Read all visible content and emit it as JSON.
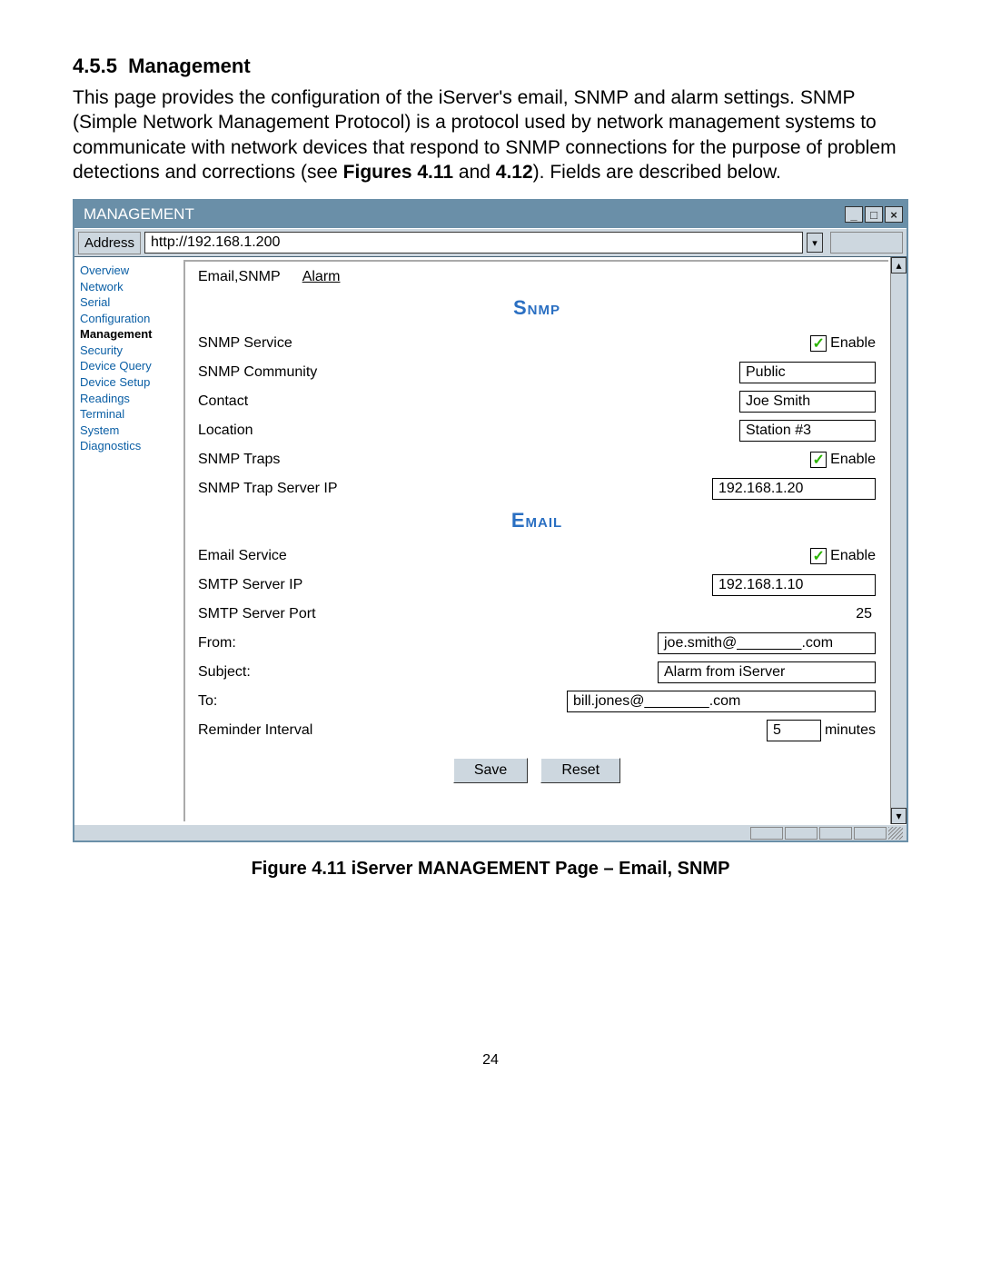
{
  "doc": {
    "section_number": "4.5.5",
    "section_title": "Management",
    "paragraph_pre": "This page provides the configuration of the iServer's email, SNMP and alarm settings. SNMP (Simple Network Management Protocol) is a protocol used by network management systems to communicate with network devices that respond to SNMP connections for the purpose of problem detections and corrections (see ",
    "figures_ref": "Figures 4.11",
    "and": " and ",
    "figures_ref2": "4.12",
    "paragraph_post": "). Fields are described below."
  },
  "window": {
    "title": "MANAGEMENT",
    "address_label": "Address",
    "address_value": "http://192.168.1.200"
  },
  "sidebar": {
    "items": [
      {
        "label": "Overview",
        "active": false
      },
      {
        "label": "Network",
        "active": false
      },
      {
        "label": "Serial",
        "active": false
      },
      {
        "label": "Configuration",
        "active": false
      },
      {
        "label": "Management",
        "active": true
      },
      {
        "label": "Security",
        "active": false
      },
      {
        "label": "Device Query",
        "active": false
      },
      {
        "label": "Device Setup",
        "active": false
      },
      {
        "label": "Readings",
        "active": false
      },
      {
        "label": "Terminal",
        "active": false
      },
      {
        "label": "System",
        "active": false
      },
      {
        "label": "Diagnostics",
        "active": false
      }
    ]
  },
  "tabs": {
    "email_snmp": "Email,SNMP",
    "alarm": "Alarm"
  },
  "snmp": {
    "heading": "Snmp",
    "service_label": "SNMP Service",
    "enable_label": "Enable",
    "community_label": "SNMP  Community",
    "community_value": "Public",
    "contact_label": "Contact",
    "contact_value": "Joe Smith",
    "location_label": "Location",
    "location_value": "Station #3",
    "traps_label": "SNMP Traps",
    "trap_server_label": "SNMP Trap Server IP",
    "trap_server_value": "192.168.1.20"
  },
  "email": {
    "heading": "Email",
    "service_label": "Email Service",
    "enable_label": "Enable",
    "smtp_ip_label": "SMTP Server IP",
    "smtp_ip_value": "192.168.1.10",
    "smtp_port_label": "SMTP Server Port",
    "smtp_port_value": "25",
    "from_label": "From:",
    "from_value": "joe.smith@________.com",
    "subject_label": "Subject:",
    "subject_value": "Alarm from iServer",
    "to_label": "To:",
    "to_value": "bill.jones@________.com",
    "reminder_label": "Reminder Interval",
    "reminder_value": "5",
    "reminder_unit": "minutes"
  },
  "buttons": {
    "save": "Save",
    "reset": "Reset"
  },
  "caption": "Figure 4.11  iServer MANAGEMENT Page – Email, SNMP",
  "page_number": "24"
}
